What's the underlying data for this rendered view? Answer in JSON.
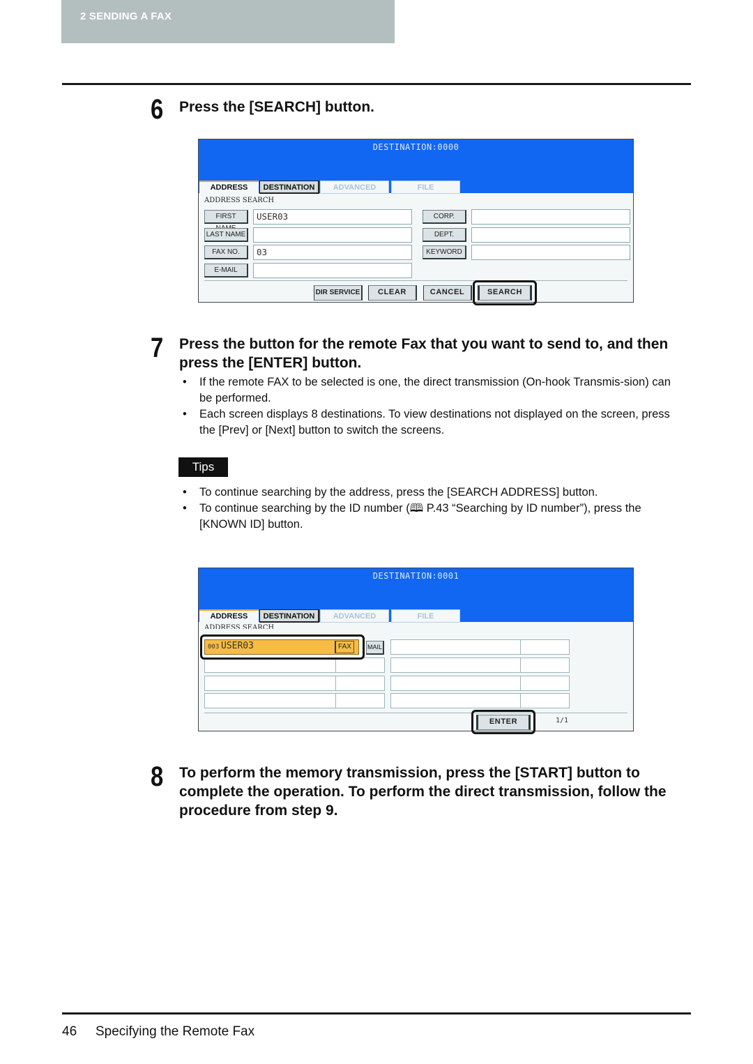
{
  "header": {
    "chapter_label": "2   SENDING A FAX"
  },
  "steps": [
    {
      "number": "6",
      "title": "Press the [SEARCH] button."
    },
    {
      "number": "7",
      "title": "Press the button for the remote Fax that you want to send to, and then press the [ENTER] button.",
      "bullets": [
        "If the remote FAX to be selected is one, the direct transmission (On-hook Transmis-sion) can be performed.",
        "Each screen displays 8 destinations. To view destinations not displayed on the screen, press the [Prev] or [Next] button to switch the screens."
      ]
    },
    {
      "number": "8",
      "title": "To perform the memory transmission, press the [START] button to complete the operation. To perform the direct transmission, follow the procedure from step 9."
    }
  ],
  "tips": {
    "label": "Tips",
    "bullets": [
      "To continue searching by the address, press the [SEARCH ADDRESS] button.",
      "To continue searching by the ID number (🕮 P.43 “Searching by ID number”), press the [KNOWN ID] button."
    ]
  },
  "screen1": {
    "destination": "DESTINATION:0000",
    "tabs": [
      "ADDRESS",
      "DESTINATION",
      "ADVANCED",
      "FILE"
    ],
    "section_label": "ADDRESS SEARCH",
    "fields": {
      "first_name": {
        "label": "FIRST NAME",
        "value": "USER03"
      },
      "last_name": {
        "label": "LAST NAME",
        "value": ""
      },
      "fax_no": {
        "label": "FAX NO.",
        "value": "03"
      },
      "email": {
        "label": "E-MAIL",
        "value": ""
      },
      "corp": {
        "label": "CORP.",
        "value": ""
      },
      "dept": {
        "label": "DEPT.",
        "value": ""
      },
      "keyword": {
        "label": "KEYWORD",
        "value": ""
      }
    },
    "buttons": {
      "dir_service": "DIR SERVICE",
      "clear": "CLEAR",
      "cancel": "CANCEL",
      "search": "SEARCH"
    }
  },
  "screen2": {
    "destination": "DESTINATION:0001",
    "tabs": [
      "ADDRESS",
      "DESTINATION",
      "ADVANCED",
      "FILE"
    ],
    "section_label": "ADDRESS SEARCH",
    "result": {
      "index": "003",
      "name": "USER03",
      "type": "FAX"
    },
    "mail_tag": "MAIL",
    "enter": "ENTER",
    "page": "1/1"
  },
  "footer": {
    "page_number": "46",
    "title": "Specifying the Remote Fax"
  }
}
